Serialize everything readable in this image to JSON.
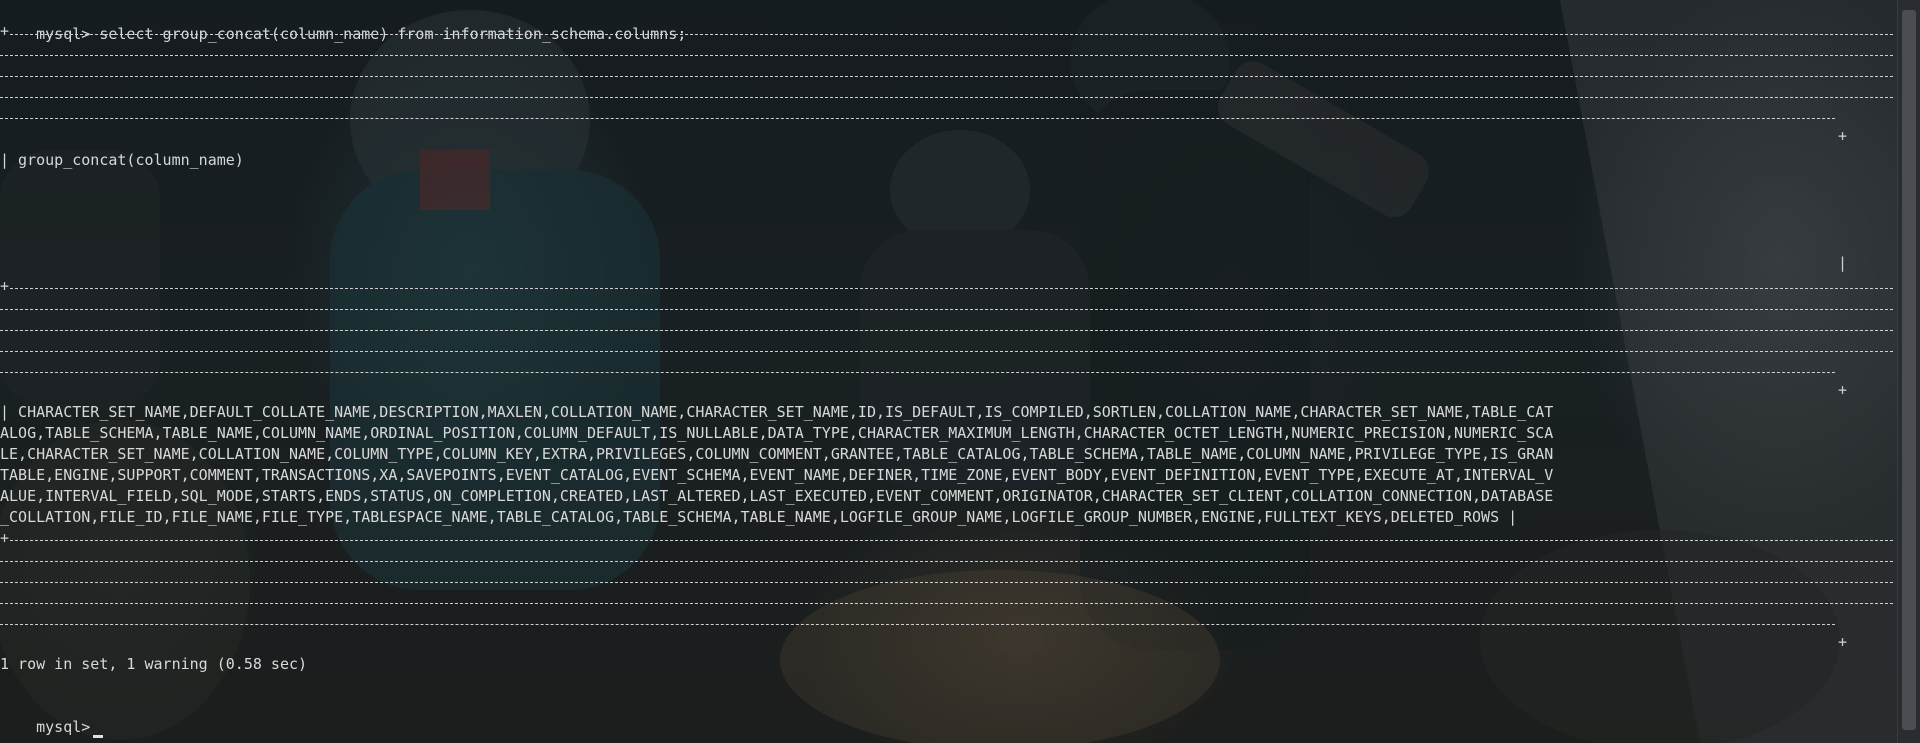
{
  "terminal": {
    "prompt": "mysql>",
    "command": "select group_concat(column_name) from information_schema.columns;",
    "header_cell": "| group_concat(column_name)",
    "result_rows": [
      "| CHARACTER_SET_NAME,DEFAULT_COLLATE_NAME,DESCRIPTION,MAXLEN,COLLATION_NAME,CHARACTER_SET_NAME,ID,IS_DEFAULT,IS_COMPILED,SORTLEN,COLLATION_NAME,CHARACTER_SET_NAME,TABLE_CAT",
      "ALOG,TABLE_SCHEMA,TABLE_NAME,COLUMN_NAME,ORDINAL_POSITION,COLUMN_DEFAULT,IS_NULLABLE,DATA_TYPE,CHARACTER_MAXIMUM_LENGTH,CHARACTER_OCTET_LENGTH,NUMERIC_PRECISION,NUMERIC_SCA",
      "LE,CHARACTER_SET_NAME,COLLATION_NAME,COLUMN_TYPE,COLUMN_KEY,EXTRA,PRIVILEGES,COLUMN_COMMENT,GRANTEE,TABLE_CATALOG,TABLE_SCHEMA,TABLE_NAME,COLUMN_NAME,PRIVILEGE_TYPE,IS_GRAN",
      "TABLE,ENGINE,SUPPORT,COMMENT,TRANSACTIONS,XA,SAVEPOINTS,EVENT_CATALOG,EVENT_SCHEMA,EVENT_NAME,DEFINER,TIME_ZONE,EVENT_BODY,EVENT_DEFINITION,EVENT_TYPE,EXECUTE_AT,INTERVAL_V",
      "ALUE,INTERVAL_FIELD,SQL_MODE,STARTS,ENDS,STATUS,ON_COMPLETION,CREATED,LAST_ALTERED,LAST_EXECUTED,EVENT_COMMENT,ORIGINATOR,CHARACTER_SET_CLIENT,COLLATION_CONNECTION,DATABASE",
      "_COLLATION,FILE_ID,FILE_NAME,FILE_TYPE,TABLESPACE_NAME,TABLE_CATALOG,TABLE_SCHEMA,TABLE_NAME,LOGFILE_GROUP_NAME,LOGFILE_GROUP_NUMBER,ENGINE,FULLTEXT_KEYS,DELETED_ROWS |"
    ],
    "summary": "1 row in set, 1 warning (0.58 sec)",
    "final_prompt": "mysql>",
    "border_corner": "+",
    "border_bar": "|"
  },
  "colors": {
    "text": "#d8d8d8",
    "background": "#1d2427"
  },
  "icons": {
    "cursor": "block-cursor"
  }
}
